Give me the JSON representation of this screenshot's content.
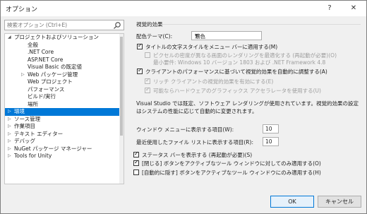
{
  "window": {
    "title": "オプション",
    "help_label": "?",
    "close_label": "✕"
  },
  "search": {
    "placeholder": "検索オプション (Ctrl+E)"
  },
  "tree": {
    "items": [
      {
        "label": "プロジェクトおよびソリューション",
        "expanded": true
      },
      {
        "label": "全般"
      },
      {
        "label": ".NET Core"
      },
      {
        "label": "ASP.NET Core"
      },
      {
        "label": "Visual Basic の既定値"
      },
      {
        "label": "Web パッケージ管理"
      },
      {
        "label": "Web プロジェクト"
      },
      {
        "label": "パフォーマンス"
      },
      {
        "label": "ビルド/実行"
      },
      {
        "label": "場所"
      },
      {
        "label": "環境",
        "selected": true
      },
      {
        "label": "ソース管理"
      },
      {
        "label": "作業項目"
      },
      {
        "label": "テキスト エディター"
      },
      {
        "label": "デバッグ"
      },
      {
        "label": "NuGet パッケージ マネージャー"
      },
      {
        "label": "Tools for Unity"
      }
    ]
  },
  "visual": {
    "section_title": "視覚的効果",
    "theme_label": "配色テーマ(C):",
    "theme_value": "濃色",
    "opt_title_style": "タイトルの文字スタイルをメニュー バーに適用する(M)",
    "opt_optimize_dpi": "ピクセルの密度が異なる画面のレンダリングを最適化する (再起動が必要)(O)",
    "opt_optimize_dpi_note": "最小要件: Windows 10 バージョン 1803 および .NET Framework 4.8",
    "opt_auto_adjust": "クライアントのパフォーマンスに基づいて視覚的効果を自動的に調整する(A)",
    "opt_rich_client": "リッチ クライアントの視覚的効果を有効にする(E)",
    "opt_hw_accel": "可能ならハードウェアのグラフィックス アクセラレータを使用する(U)",
    "description": "Visual Studio では既定、ソフトウェア レンダリングが使用されています。視覚的効果の設定はシステムの性能に応じて自動的に変更されます。"
  },
  "window_menu": {
    "label": "ウィンドウ メニューに表示する項目(W):",
    "value": "10"
  },
  "recent_files": {
    "label": "最近使用したファイル リストに表示する項目(R):",
    "value": "10"
  },
  "status_bar": {
    "label": "ステータス バーを表示する (再起動が必要)(S)"
  },
  "close_button_opt": {
    "label": "[閉じる] ボタンをアクティブなツール ウィンドウに対してのみ適用する(O)"
  },
  "autohide_opt": {
    "label": "[自動的に隠す] ボタンをアクティブなツール ウィンドウにのみ適用する(H)"
  },
  "buttons": {
    "ok": "OK",
    "cancel": "キャンセル"
  }
}
